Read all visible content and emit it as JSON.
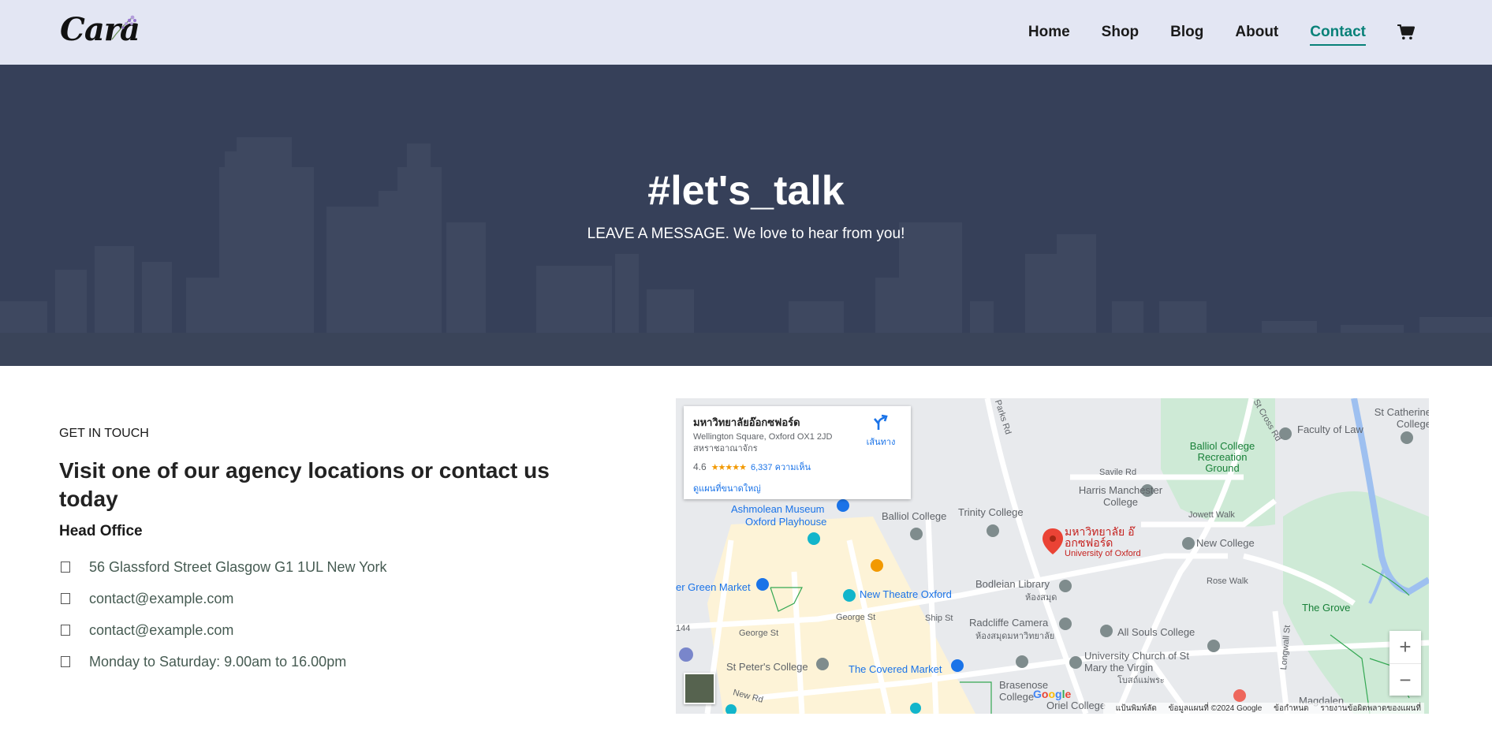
{
  "header": {
    "logo": "Cara",
    "nav": [
      "Home",
      "Shop",
      "Blog",
      "About",
      "Contact"
    ],
    "active_nav": "Contact",
    "cart_icon": "cart-icon"
  },
  "hero": {
    "title": "#let's_talk",
    "subtitle": "LEAVE A MESSAGE. We love to hear from you!"
  },
  "details": {
    "eyebrow": "GET IN TOUCH",
    "heading": "Visit one of our agency locations or contact us today",
    "office_title": "Head Office",
    "items": [
      {
        "icon": "map-icon",
        "text": "56 Glassford Street Glasgow G1 1UL New York"
      },
      {
        "icon": "envelope-icon",
        "text": "contact@example.com"
      },
      {
        "icon": "phone-icon",
        "text": "contact@example.com"
      },
      {
        "icon": "clock-icon",
        "text": "Monday to Saturday: 9.00am to 16.00pm"
      }
    ]
  },
  "map": {
    "card": {
      "title": "มหาวิทยาลัยอ๊อกซฟอร์ด",
      "address_line1": "Wellington Square, Oxford OX1 2JD",
      "address_line2": "สหราชอาณาจักร",
      "rating": "4.6",
      "stars": "★★★★★",
      "reviews": "6,337 ความเห็น",
      "larger_map": "ดูแผนที่ขนาดใหญ่",
      "directions": "เส้นทาง"
    },
    "labels": {
      "ashmolean": "Ashmolean Museum",
      "playhouse": "Oxford Playhouse",
      "balliol": "Balliol College",
      "trinity": "Trinity College",
      "harris": "Harris Manchester College",
      "balliol_ground": "Balliol College Recreation Ground",
      "faculty_law": "Faculty of Law",
      "st_catherine": "St Catherine College",
      "savile": "Savile Rd",
      "jowett": "Jowett Walk",
      "new_college": "New College",
      "rose_walk": "Rose Walk",
      "grove": "The Grove",
      "uni_pin_th": "มหาวิทยาลัย อ๊อกซฟอร์ด",
      "uni_pin_en": "University of Oxford",
      "bodleian": "Bodleian Library",
      "bodleian_th": "ห้องสมุด",
      "new_theatre": "New Theatre Oxford",
      "green_market": "er Green Market",
      "george_st": "George St",
      "george_st2": "George St",
      "radcliffe": "Radcliffe Camera",
      "radcliffe_th": "ห้องสมุดมหาวิทยาลัย",
      "ship_st": "Ship St",
      "all_souls": "All Souls College",
      "st_mary": "University Church of St Mary the Virgin",
      "st_mary_th": "โบสถ์แม่พระ",
      "st_peters": "St Peter's College",
      "covered_market": "The Covered Market",
      "brasenose": "Brasenose College",
      "oriel": "Oriel College",
      "magdalen": "Magdalen",
      "new_rd": "New Rd",
      "parks_rd": "Parks Rd",
      "st_cross": "St Cross Rd",
      "longwall": "Longwall St",
      "route144": "144"
    },
    "google": "Google",
    "attribution": [
      "แป้นพิมพ์ลัด",
      "ข้อมูลแผนที่ ©2024 Google",
      "ข้อกำหนด",
      "รายงานข้อผิดพลาดของแผนที่"
    ],
    "zoom_in": "+",
    "zoom_out": "−"
  }
}
